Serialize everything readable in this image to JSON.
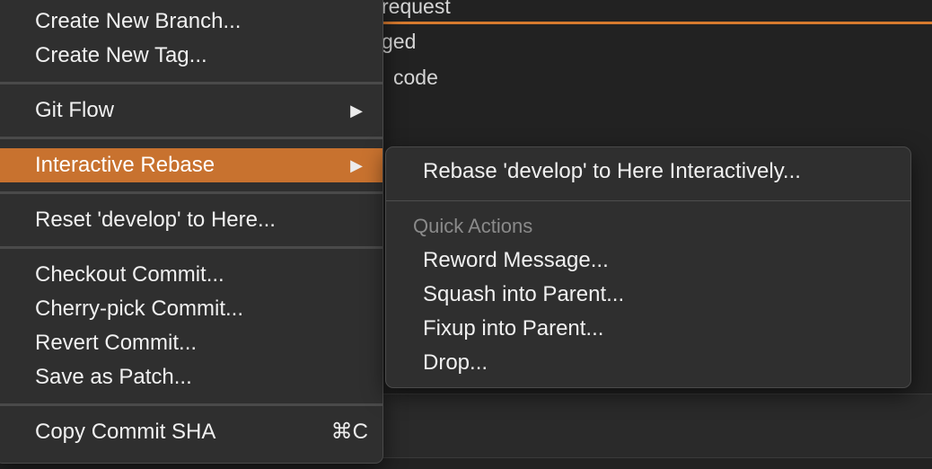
{
  "background": {
    "rows": [
      {
        "text": "request"
      },
      {
        "text": "ged"
      },
      {
        "text": "code"
      }
    ]
  },
  "main_menu": {
    "items": [
      {
        "label": "Create New Branch..."
      },
      {
        "label": "Create New Tag..."
      },
      {
        "label": "Git Flow",
        "arrow": "▶"
      },
      {
        "label": "Interactive Rebase",
        "arrow": "▶"
      },
      {
        "label": "Reset 'develop' to Here..."
      },
      {
        "label": "Checkout Commit..."
      },
      {
        "label": "Cherry-pick Commit..."
      },
      {
        "label": "Revert Commit..."
      },
      {
        "label": "Save as Patch..."
      },
      {
        "label": "Copy Commit SHA",
        "shortcut": "⌘C"
      }
    ]
  },
  "sub_menu": {
    "primary": {
      "label": "Rebase 'develop' to Here Interactively..."
    },
    "section_header": "Quick Actions",
    "items": [
      {
        "label": "Reword Message..."
      },
      {
        "label": "Squash into Parent..."
      },
      {
        "label": "Fixup into Parent..."
      },
      {
        "label": "Drop..."
      }
    ]
  },
  "colors": {
    "accent": "#c8722f",
    "menu_bg": "#2f2f2f",
    "text": "#f0f0f0"
  }
}
